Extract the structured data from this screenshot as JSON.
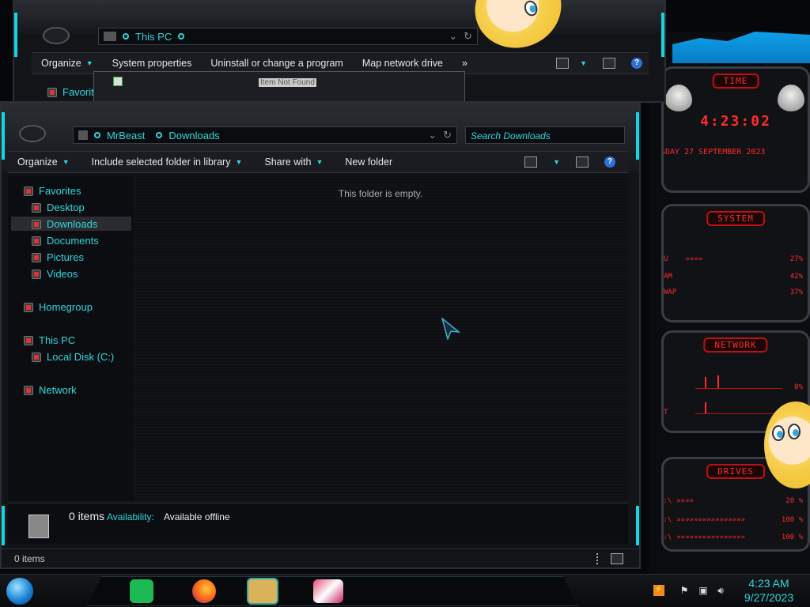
{
  "back_window": {
    "address": {
      "location": "This PC"
    },
    "toolbar": {
      "organize": "Organize",
      "system_properties": "System properties",
      "uninstall": "Uninstall or change a program",
      "map_drive": "Map network drive",
      "more": "»"
    },
    "nav_favorites_partial": "Favorit",
    "overlay_text": "Item Not Found"
  },
  "front_window": {
    "address": {
      "segment1": "MrBeast",
      "segment2": "Downloads"
    },
    "search_placeholder": "Search Downloads",
    "toolbar": {
      "organize": "Organize",
      "include": "Include selected folder in library",
      "share": "Share with",
      "new_folder": "New folder"
    },
    "nav": {
      "favorites": "Favorites",
      "desktop": "Desktop",
      "downloads": "Downloads",
      "documents": "Documents",
      "pictures": "Pictures",
      "videos": "Videos",
      "homegroup": "Homegroup",
      "this_pc": "This PC",
      "local_disk": "Local Disk (C:)",
      "network": "Network"
    },
    "empty_message": "This folder is empty.",
    "details": {
      "items": "0 items",
      "availability_label": "Availability:",
      "availability_value": "Available offline"
    },
    "status": {
      "items": "0 items"
    }
  },
  "widgets": {
    "time": {
      "title": "TIME",
      "clock": "4:23:02",
      "date": "SDAY 27 SEPTEMBER 2023"
    },
    "system": {
      "title": "SYSTEM",
      "rows": [
        {
          "label": "U",
          "value": "27%"
        },
        {
          "label": "AM",
          "value": "42%"
        },
        {
          "label": "WAP",
          "value": "37%"
        }
      ]
    },
    "network": {
      "title": "NETWORK",
      "rows": [
        {
          "label": "",
          "value": "0%"
        },
        {
          "label": "T",
          "value": ""
        }
      ]
    },
    "drives": {
      "title": "DRIVES",
      "rows": [
        {
          "label": "C:\\",
          "value": "28 %"
        },
        {
          "label": "F:\\",
          "value": "100 %"
        },
        {
          "label": "G:\\",
          "value": "100 %"
        }
      ]
    }
  },
  "taskbar": {
    "time": "4:23 AM",
    "date": "9/27/2023"
  },
  "colors": {
    "accent": "#18d4e0",
    "widget_red": "#ff2b2b"
  }
}
